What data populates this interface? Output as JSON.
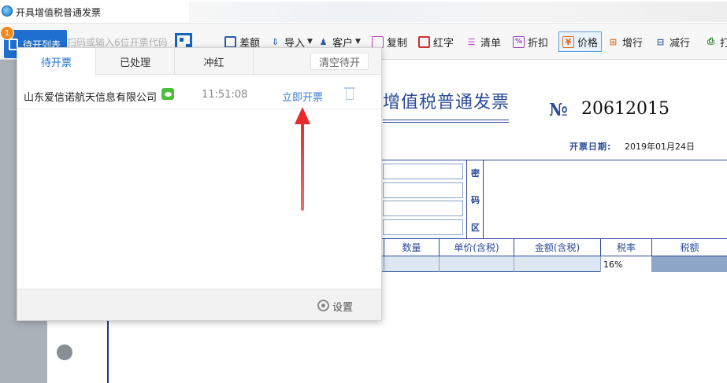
{
  "window": {
    "title": "开具增值税普通发票"
  },
  "toolbar": {
    "pending_list_label": "待开列表",
    "pending_badge": "1",
    "scan_placeholder": "扫码或输入6位开票代码",
    "items": [
      {
        "label": "差额",
        "icon": "diff-icon"
      },
      {
        "label": "导入",
        "icon": "import-icon",
        "has_caret": true
      },
      {
        "label": "客户",
        "icon": "customer-icon",
        "has_caret": true
      },
      {
        "label": "复制",
        "icon": "copy-icon"
      },
      {
        "label": "红字",
        "icon": "red-invoice-icon"
      },
      {
        "label": "清单",
        "icon": "list-icon"
      },
      {
        "label": "折扣",
        "icon": "discount-icon"
      },
      {
        "label": "价格",
        "icon": "price-icon",
        "active": true
      },
      {
        "label": "增行",
        "icon": "add-row-icon"
      },
      {
        "label": "减行",
        "icon": "remove-row-icon"
      },
      {
        "label": "打",
        "icon": "print-icon"
      }
    ]
  },
  "popup": {
    "tabs": [
      {
        "label": "待开票",
        "active": true
      },
      {
        "label": "已处理"
      },
      {
        "label": "冲红"
      }
    ],
    "clear_button": "清空待开",
    "rows": [
      {
        "company": "山东爱信诺航天信息有限公司",
        "time": "11:51:08",
        "action": "立即开票"
      }
    ],
    "settings_label": "设置"
  },
  "invoice": {
    "title": "增值税普通发票",
    "number_label": "№",
    "number": "20612015",
    "date_label": "开票日期:",
    "date": "2019年01月24日",
    "password_area_chars": [
      "密",
      "码",
      "区"
    ],
    "columns": [
      "数量",
      "单价(含税)",
      "金额(含税)",
      "税率",
      "税额"
    ],
    "row": {
      "tax_rate": "16%"
    }
  },
  "colors": {
    "accent_blue": "#1e6fce",
    "invoice_blue": "#2a4a9a",
    "arrow_red": "#e52b2b",
    "badge_orange": "#f08a1c"
  }
}
